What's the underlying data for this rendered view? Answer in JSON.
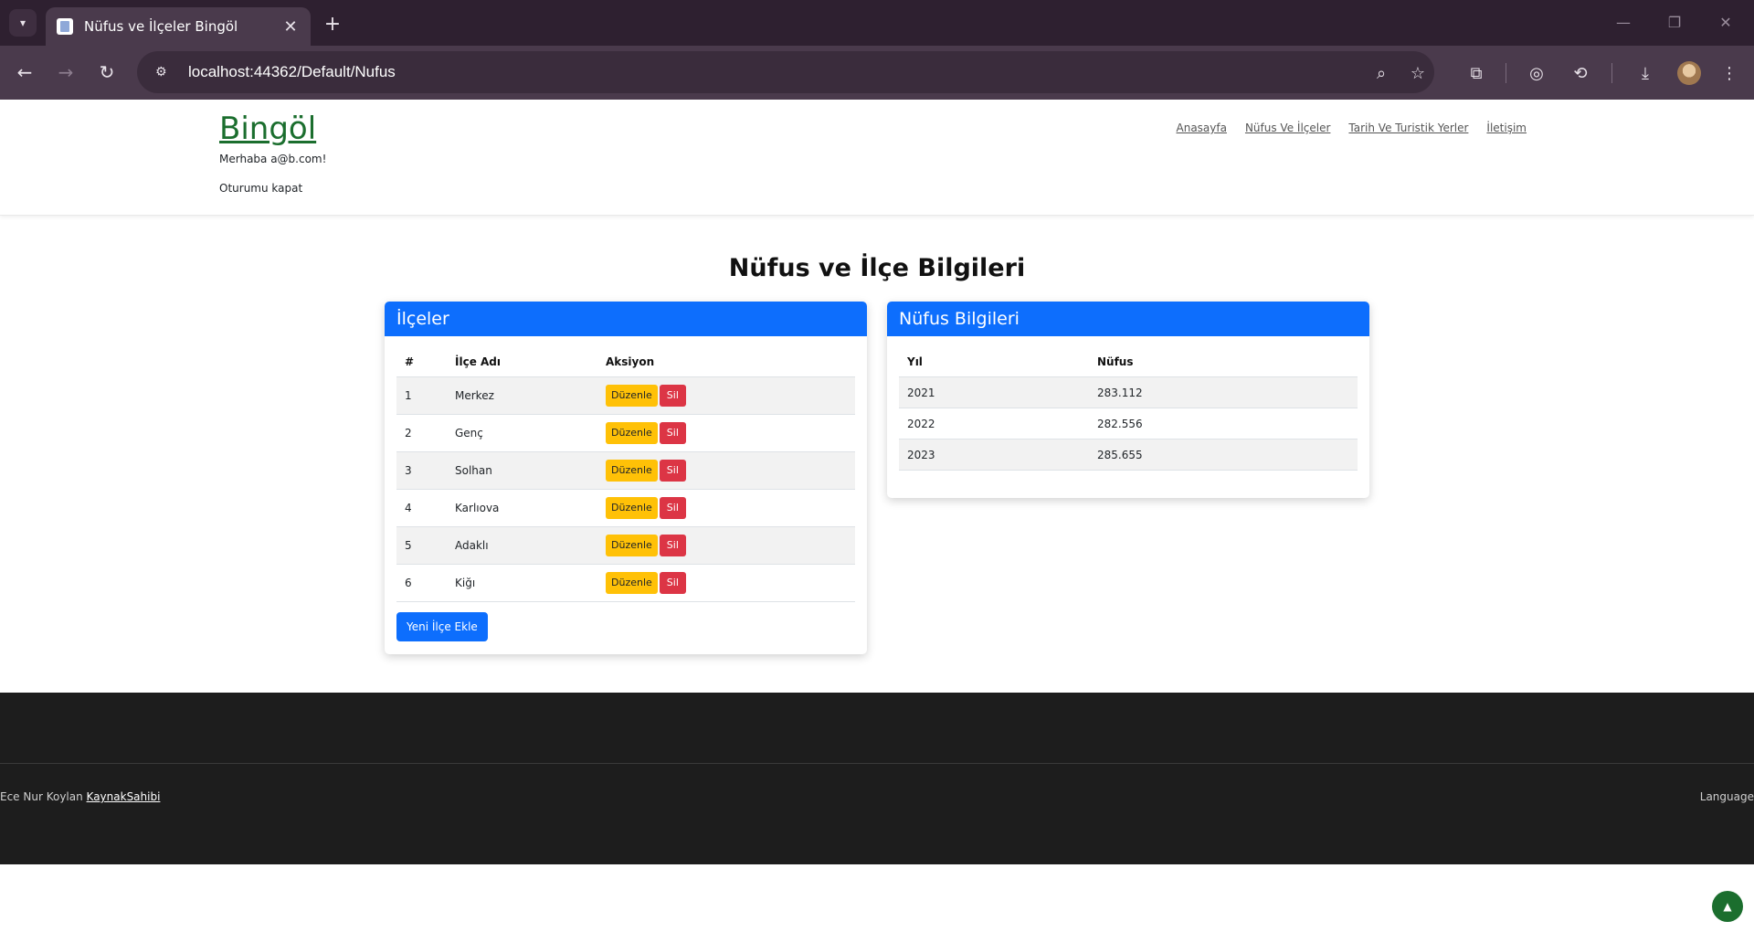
{
  "browser": {
    "tab_title": "Nüfus ve İlçeler Bingöl",
    "tab_close": "✕",
    "new_tab": "+",
    "url": "localhost:44362/Default/Nufus"
  },
  "header": {
    "brand": "Bingöl",
    "greeting": "Merhaba a@b.com!",
    "logout": "Oturumu kapat",
    "nav": [
      "Anasayfa",
      "Nüfus Ve İlçeler",
      "Tarih Ve Turistik Yerler",
      "İletişim"
    ]
  },
  "page_title": "Nüfus ve İlçe Bilgileri",
  "districts": {
    "title": "İlçeler",
    "columns": [
      "#",
      "İlçe Adı",
      "Aksiyon"
    ],
    "rows": [
      {
        "no": "1",
        "name": "Merkez"
      },
      {
        "no": "2",
        "name": "Genç"
      },
      {
        "no": "3",
        "name": "Solhan"
      },
      {
        "no": "4",
        "name": "Karlıova"
      },
      {
        "no": "5",
        "name": "Adaklı"
      },
      {
        "no": "6",
        "name": "Kiğı"
      }
    ],
    "edit_label": "Düzenle",
    "delete_label": "Sil",
    "add_label": "Yeni İlçe Ekle"
  },
  "population": {
    "title": "Nüfus Bilgileri",
    "columns": [
      "Yıl",
      "Nüfus"
    ],
    "rows": [
      {
        "year": "2021",
        "value": "283.112"
      },
      {
        "year": "2022",
        "value": "282.556"
      },
      {
        "year": "2023",
        "value": "285.655"
      }
    ]
  },
  "footer": {
    "author": "Ece Nur Koylan",
    "link": "KaynakSahibi",
    "language": "Language"
  },
  "colors": {
    "primary": "#0d6efd",
    "brand": "#1b6e2e",
    "warning": "#ffc107",
    "danger": "#dc3545",
    "footer_bg": "#1d1d1d"
  }
}
